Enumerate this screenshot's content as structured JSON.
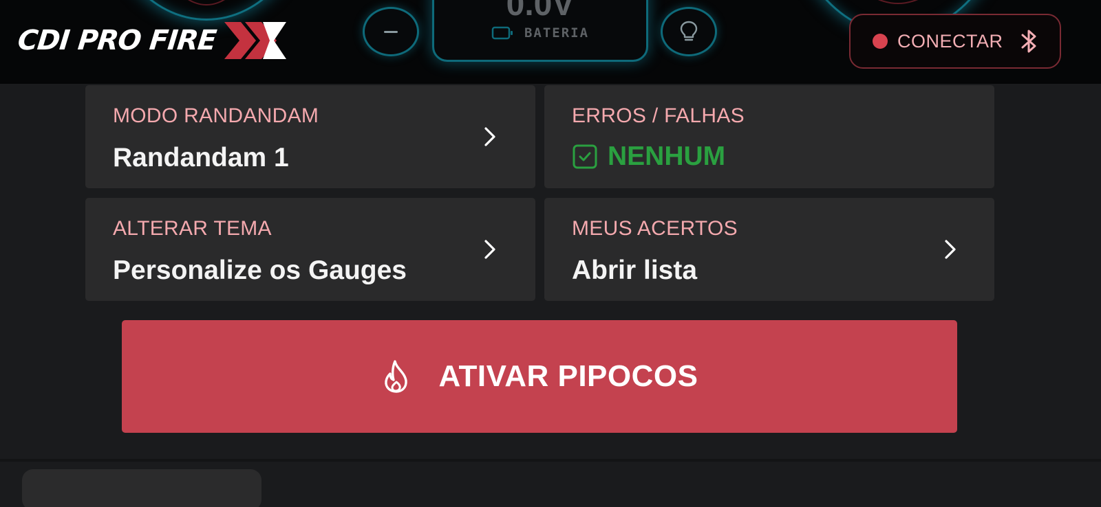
{
  "header": {
    "logo_text": "CDI PRO FIRE",
    "logo_mark_icon": "double-chevron-x-logo",
    "voltage_value": "0.0V",
    "battery_label": "BATERIA",
    "connect_label": "CONECTAR",
    "colors": {
      "accent": "#c4424f",
      "glow": "#0e6a7a",
      "status_dot": "#d8434f"
    }
  },
  "cards": [
    {
      "label": "MODO RANDANDAM",
      "value": "Randandam 1"
    },
    {
      "label": "ERROS / FALHAS",
      "value": "NENHUM",
      "status_color": "#2aa040"
    },
    {
      "label": "ALTERAR TEMA",
      "value": "Personalize os Gauges"
    },
    {
      "label": "MEUS ACERTOS",
      "value": "Abrir lista"
    }
  ],
  "cta": {
    "label": "ATIVAR PIPOCOS",
    "color": "#c4424f"
  }
}
